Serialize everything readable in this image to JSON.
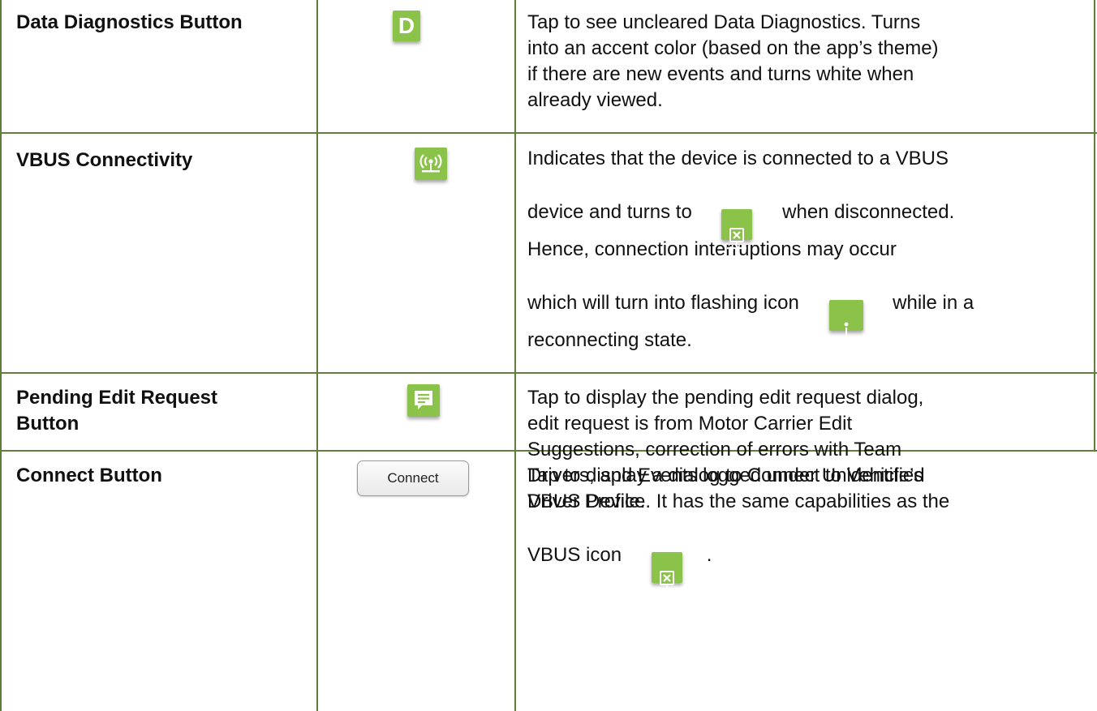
{
  "rows": [
    {
      "label": "Data Diagnostics Button",
      "icon": "data-diagnostics-icon",
      "icon_letter": "D",
      "desc": [
        "Tap to see uncleared Data Diagnostics. Turns",
        "into an accent color (based on the app’s theme)",
        "if there are new events and turns white when",
        "already viewed."
      ]
    },
    {
      "label": "VBUS Connectivity",
      "icon": "vbus-connected-icon",
      "desc_1": "Indicates that the device is connected to a VBUS",
      "desc_2a": "device and turns to",
      "desc_2b": "when disconnected.",
      "desc_3": "Hence, connection interruptions may occur",
      "desc_4a": "which will turn into flashing icon",
      "desc_4b": "while in a",
      "desc_5": "reconnecting state."
    },
    {
      "label_1": "Pending Edit Request",
      "label_2": "Button",
      "icon": "pending-edit-request-icon",
      "desc": [
        "Tap to display the pending edit request dialog,",
        "edit request is from Motor Carrier Edit",
        "Suggestions, correction of errors with Team",
        "Drivers, and Events logged under Unidentified",
        "Driver Profile."
      ]
    },
    {
      "label": "Connect Button",
      "button_label": "Connect",
      "desc_1": "Tap to display a dialog to Connect to Vehicle’s",
      "desc_2": "VBUS Device. It has the same capabilities as the",
      "desc_3a": "VBUS icon",
      "desc_3b": "."
    }
  ],
  "colors": {
    "icon_green": "#8bc34a",
    "border": "#5f7d3b"
  }
}
